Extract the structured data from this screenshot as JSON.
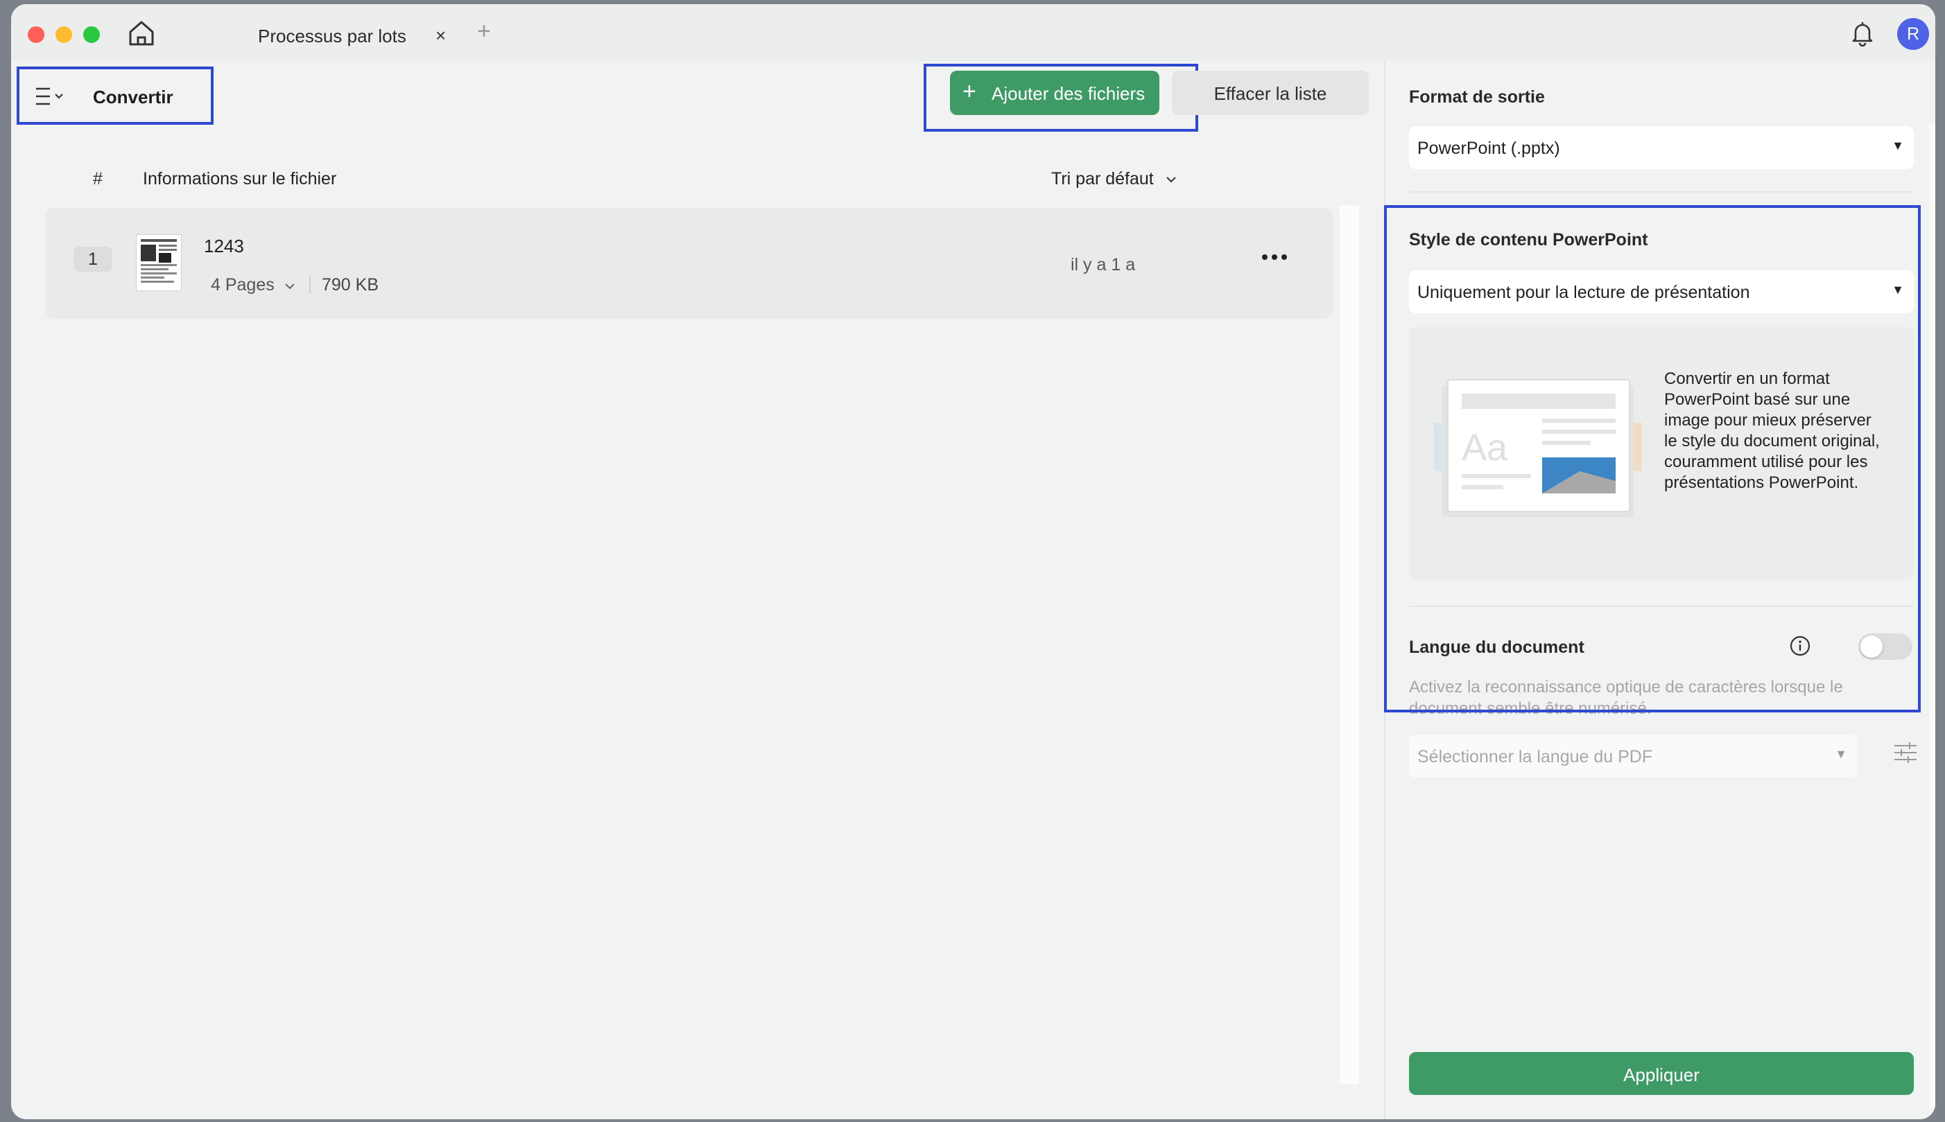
{
  "window": {
    "tab_title": "Processus par lots",
    "tab_close": "×",
    "new_tab": "+",
    "avatar_initial": "R"
  },
  "toolbar": {
    "mode_label": "Convertir",
    "add_files_label": "Ajouter des fichiers",
    "add_files_icon": "+",
    "clear_list_label": "Effacer la liste"
  },
  "file_list": {
    "col_index": "#",
    "col_info": "Informations sur le fichier",
    "sort_label": "Tri par défaut",
    "files": [
      {
        "index": "1",
        "name": "1243",
        "pages": "4 Pages",
        "size": "790 KB",
        "time": "il y a 1 a"
      }
    ]
  },
  "settings": {
    "output_format_title": "Format de sortie",
    "output_format_value": "PowerPoint (.pptx)",
    "content_style_title": "Style de contenu PowerPoint",
    "content_style_value": "Uniquement pour la lecture de présentation",
    "content_style_description": "Convertir en un format PowerPoint basé sur une image pour mieux préserver le style du document original, couramment utilisé pour les présentations PowerPoint.",
    "preview_sample_text": "Aa",
    "language_title": "Langue du document",
    "ocr_enabled": false,
    "ocr_description": "Activez la reconnaissance optique de caractères lorsque le document semble être numérisé.",
    "language_placeholder": "Sélectionner la langue du PDF",
    "apply_label": "Appliquer"
  },
  "icons": {
    "home": "home-icon",
    "bell": "bell-icon",
    "menu": "hamburger-icon",
    "more": "more-horizontal-icon",
    "info": "info-icon",
    "filter": "sliders-icon",
    "dropdown": "chevron-down-icon"
  },
  "colors": {
    "accent_green": "#3e9b66",
    "highlight_blue": "#2f49d1",
    "avatar_blue": "#4d62e6"
  }
}
